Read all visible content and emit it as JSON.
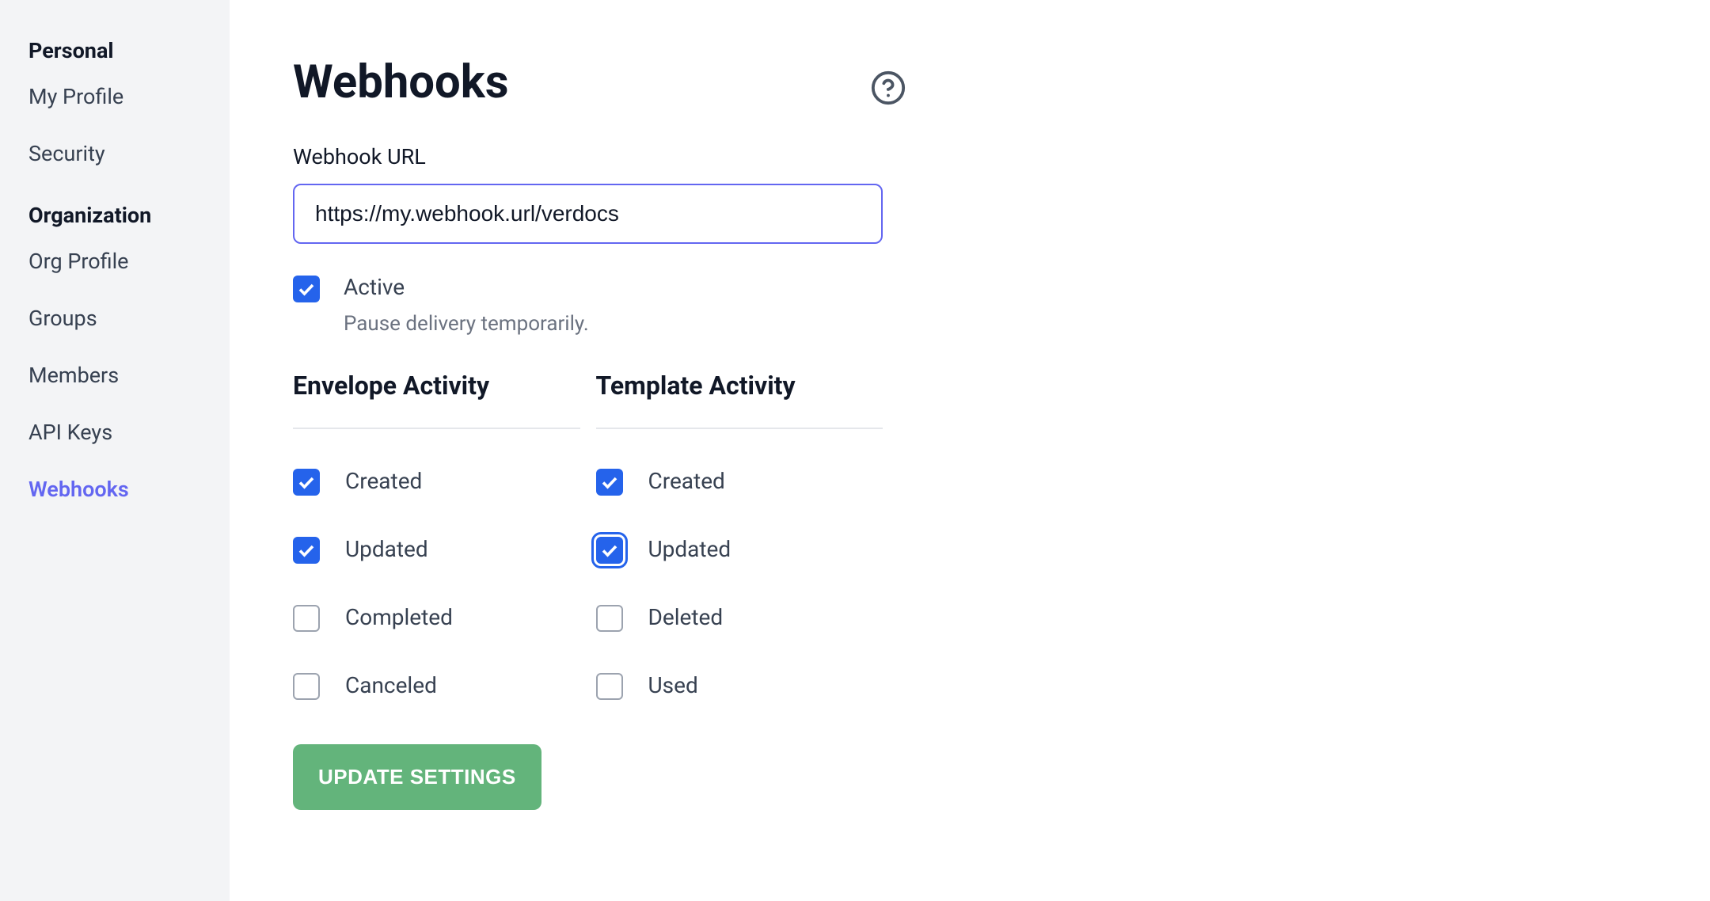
{
  "sidebar": {
    "sections": [
      {
        "heading": "Personal",
        "items": [
          {
            "label": "My Profile",
            "selected": false
          },
          {
            "label": "Security",
            "selected": false
          }
        ]
      },
      {
        "heading": "Organization",
        "items": [
          {
            "label": "Org Profile",
            "selected": false
          },
          {
            "label": "Groups",
            "selected": false
          },
          {
            "label": "Members",
            "selected": false
          },
          {
            "label": "API Keys",
            "selected": false
          },
          {
            "label": "Webhooks",
            "selected": true
          }
        ]
      }
    ]
  },
  "page": {
    "title": "Webhooks",
    "help_icon": "help-circle-icon"
  },
  "form": {
    "url_label": "Webhook URL",
    "url_value": "https://my.webhook.url/verdocs",
    "active": {
      "label": "Active",
      "help": "Pause delivery temporarily.",
      "checked": true
    },
    "envelope": {
      "heading": "Envelope Activity",
      "options": [
        {
          "key": "created",
          "label": "Created",
          "checked": true,
          "focused": false
        },
        {
          "key": "updated",
          "label": "Updated",
          "checked": true,
          "focused": false
        },
        {
          "key": "completed",
          "label": "Completed",
          "checked": false,
          "focused": false
        },
        {
          "key": "canceled",
          "label": "Canceled",
          "checked": false,
          "focused": false
        }
      ]
    },
    "template": {
      "heading": "Template Activity",
      "options": [
        {
          "key": "created",
          "label": "Created",
          "checked": true,
          "focused": false
        },
        {
          "key": "updated",
          "label": "Updated",
          "checked": true,
          "focused": true
        },
        {
          "key": "deleted",
          "label": "Deleted",
          "checked": false,
          "focused": false
        },
        {
          "key": "used",
          "label": "Used",
          "checked": false,
          "focused": false
        }
      ]
    },
    "submit_label": "Update Settings"
  },
  "colors": {
    "accent": "#6366f1",
    "checkbox": "#2563eb",
    "button": "#63b47b"
  }
}
